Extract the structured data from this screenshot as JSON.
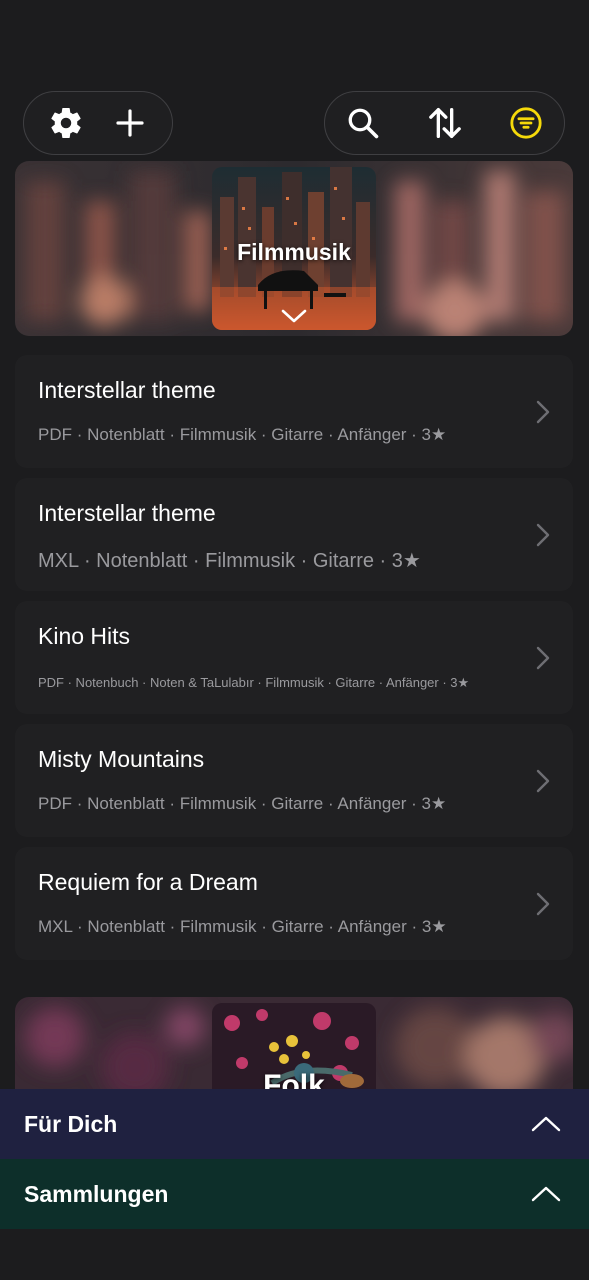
{
  "toolbar": {
    "left_icons": [
      "gear-icon",
      "plus-icon"
    ],
    "right_icons": [
      "search-icon",
      "sort-arrows-icon",
      "filter-icon"
    ],
    "accent_color": "#f5d90a"
  },
  "banners": [
    {
      "title": "Filmmusik",
      "expand_icon": "chevron-down-icon"
    },
    {
      "title": "Folk"
    }
  ],
  "items": [
    {
      "title": "Interstellar theme",
      "meta": "PDF · Notenblatt · Filmmusik · Gitarre · Anfänger · 3★"
    },
    {
      "title": "Interstellar theme",
      "meta": "MXL · Notenblatt · Filmmusik · Gitarre · 3★"
    },
    {
      "title": "Kino Hits",
      "meta": "PDF · Notenbuch · Noten & TaLulabır · Filmmusik · Gitarre · Anfänger · 3★"
    },
    {
      "title": "Misty Mountains",
      "meta": "PDF · Notenblatt · Filmmusik · Gitarre · Anfänger · 3★"
    },
    {
      "title": "Requiem for a Dream",
      "meta": "MXL · Notenblatt · Filmmusik · Gitarre · Anfänger · 3★"
    }
  ],
  "panels": [
    {
      "label": "Für Dich",
      "color": "#1f2140",
      "icon": "chevron-up-icon"
    },
    {
      "label": "Sammlungen",
      "color": "#0d2f2a",
      "icon": "chevron-up-icon"
    }
  ]
}
